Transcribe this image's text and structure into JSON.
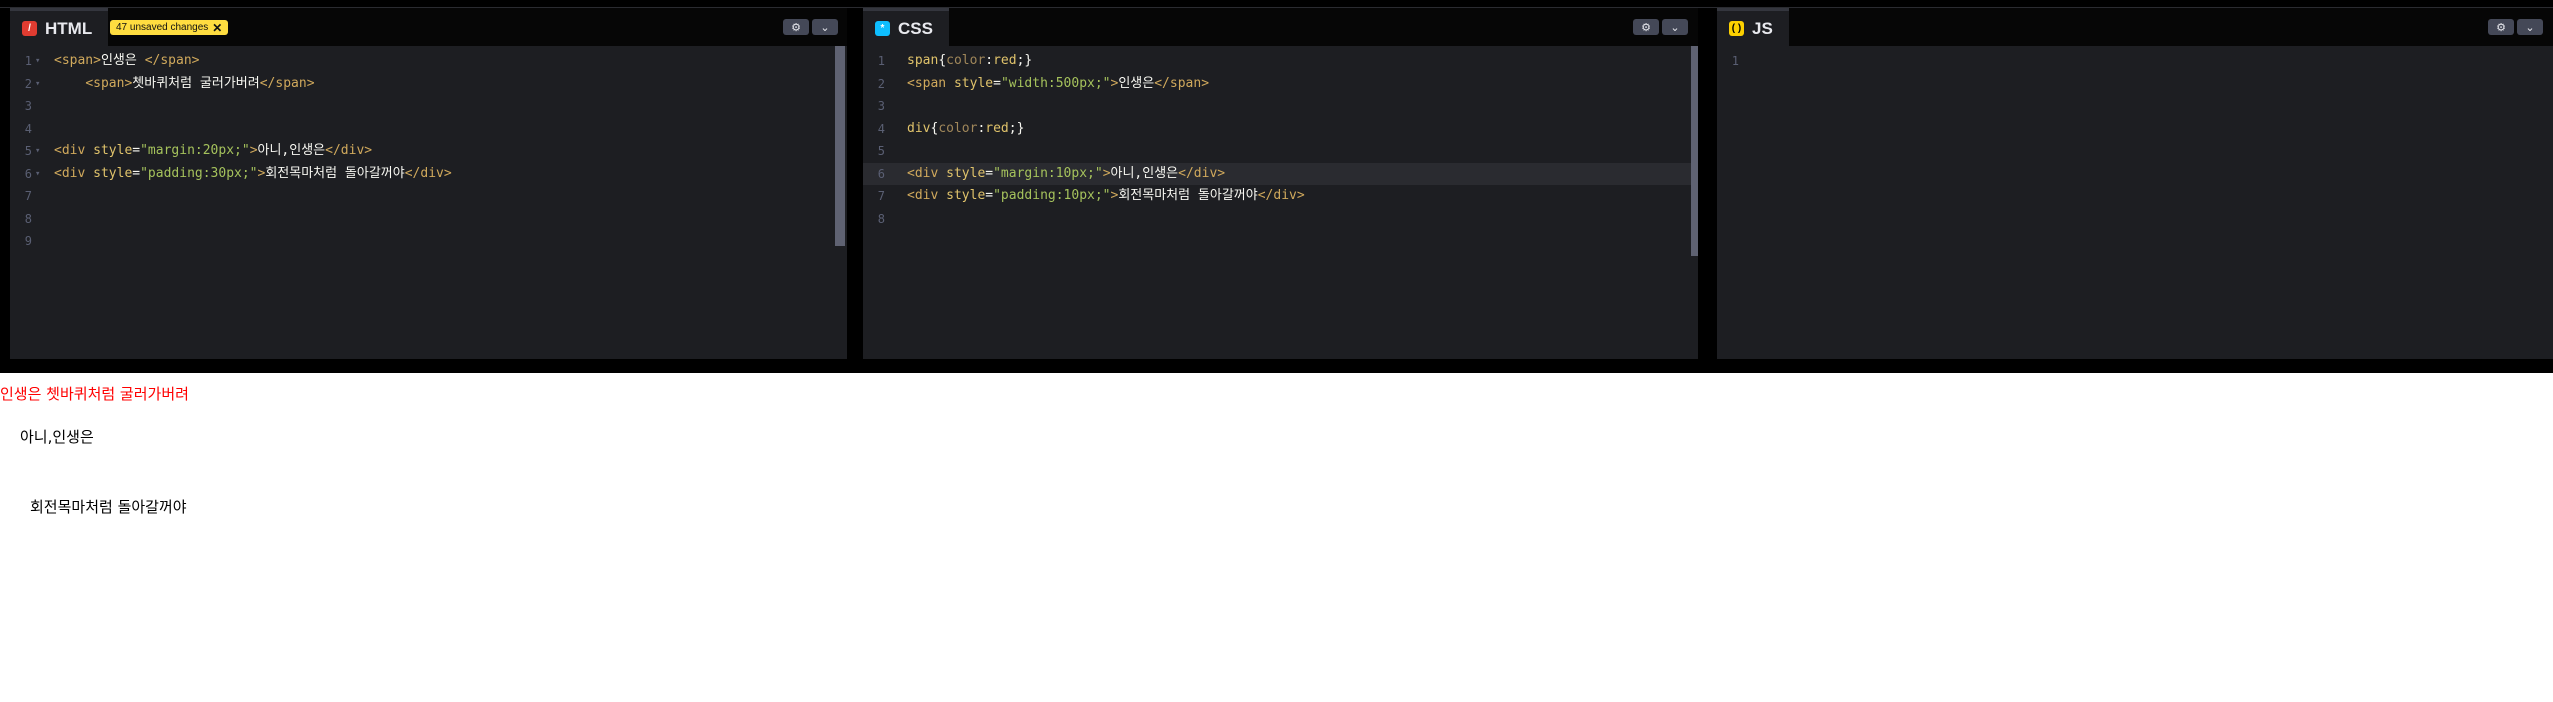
{
  "editors": {
    "html": {
      "tab_label": "HTML",
      "tab_icon": "html-icon",
      "unsaved_badge": "47 unsaved changes",
      "lines": [
        {
          "n": "1",
          "text": "<span>인생은 </span>"
        },
        {
          "n": "2",
          "text": "    <span>쳇바퀴처럼 굴러가버려</span>"
        },
        {
          "n": "3",
          "text": ""
        },
        {
          "n": "4",
          "text": ""
        },
        {
          "n": "5",
          "text": "<div style=\"margin:20px;\">아니,인생은</div>"
        },
        {
          "n": "6",
          "text": "<div style=\"padding:30px;\">회전목마처럼 돌아갈꺼야</div>"
        },
        {
          "n": "7",
          "text": ""
        },
        {
          "n": "8",
          "text": ""
        },
        {
          "n": "9",
          "text": ""
        }
      ]
    },
    "css": {
      "tab_label": "CSS",
      "tab_icon": "css-icon",
      "lines": [
        {
          "n": "1",
          "text": "span{color:red;}"
        },
        {
          "n": "2",
          "text": "<span style=\"width:500px;\">인생은</span>"
        },
        {
          "n": "3",
          "text": ""
        },
        {
          "n": "4",
          "text": "div{color:red;}"
        },
        {
          "n": "5",
          "text": ""
        },
        {
          "n": "6",
          "text": "<div style=\"margin:10px;\">아니,인생은</div>"
        },
        {
          "n": "7",
          "text": "<div style=\"padding:10px;\">회전목마처럼 돌아갈꺼야</div>"
        },
        {
          "n": "8",
          "text": ""
        }
      ]
    },
    "js": {
      "tab_label": "JS",
      "tab_icon": "js-icon",
      "lines": [
        {
          "n": "1",
          "text": ""
        }
      ]
    },
    "buttons": {
      "settings_icon": "gear-icon",
      "menu_icon": "chevron-down-icon"
    }
  },
  "preview": {
    "line1": "인생은 쳇바퀴처럼 굴러가버려",
    "line2": "아니,인생은",
    "line3": "회전목마처럼 돌아갈꺼야"
  }
}
